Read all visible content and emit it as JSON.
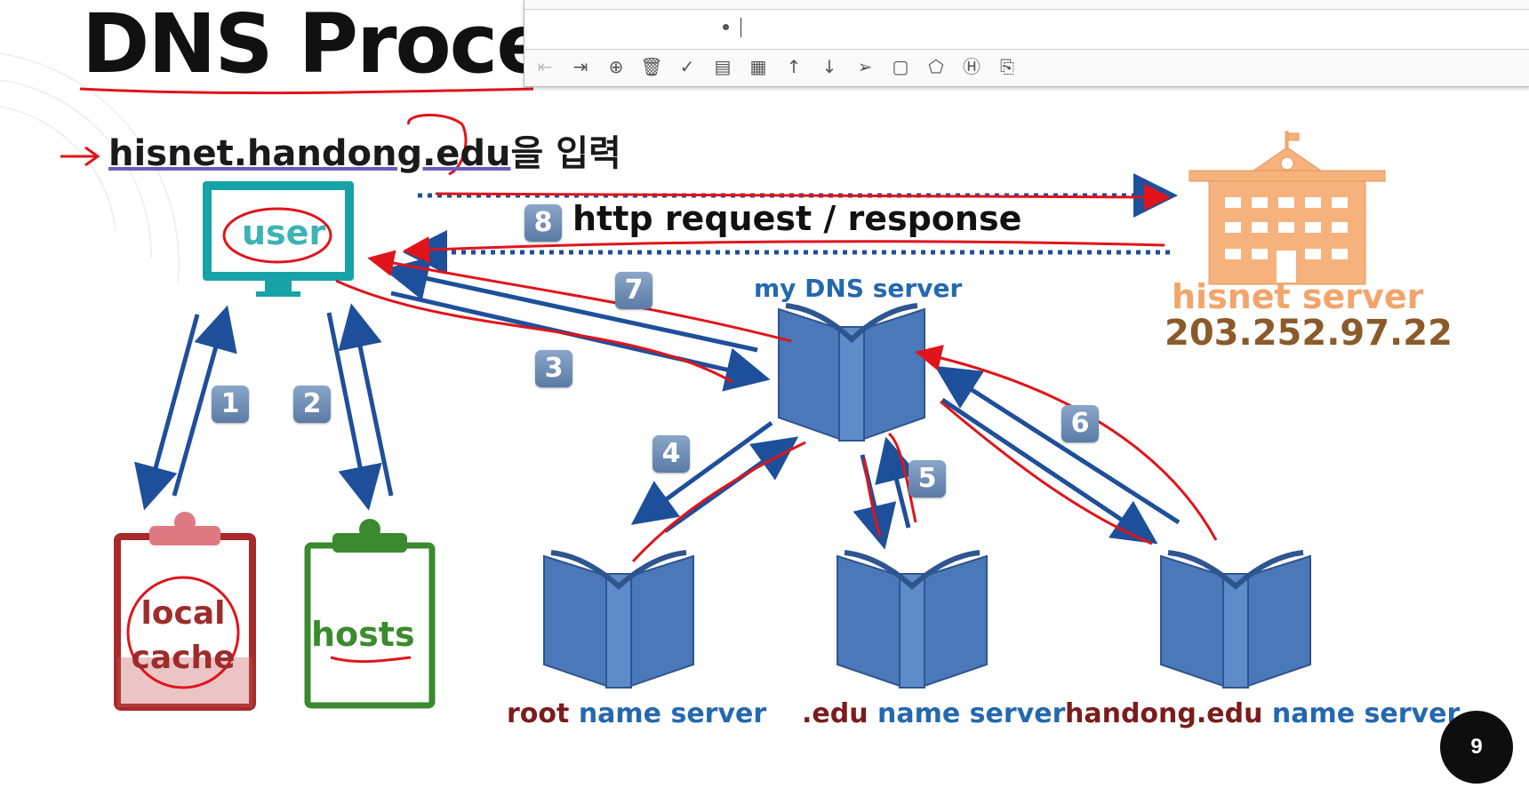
{
  "slide": {
    "title": "DNS Process",
    "instruction_url": "hisnet.handong.edu",
    "instruction_suffix": "을 입력",
    "user_label": "user",
    "local_cache_line1": "local",
    "local_cache_line2": "cache",
    "hosts_label": "hosts",
    "http_label": "http request / response",
    "my_dns_label": "my DNS server",
    "hisnet_name": "hisnet server",
    "hisnet_ip": "203.252.97.22",
    "root_prefix": "root",
    "edu_prefix": ".edu",
    "handong_prefix": "handong.edu",
    "name_server_suffix": "name server",
    "badges": [
      "1",
      "2",
      "3",
      "4",
      "5",
      "6",
      "7",
      "8"
    ],
    "page_number": "9",
    "colors": {
      "user_teal": "#17a2a6",
      "local_cache_red": "#9e2c2c",
      "hosts_green": "#3b8a2f",
      "book_blue": "#4a78b8",
      "arrow_blue": "#1e4f9a",
      "annotation_red": "#e0141a",
      "hisnet_orange": "#f5b27c"
    }
  },
  "toolbar": {
    "icons": [
      "outdent-icon",
      "indent-icon",
      "zoom-icon",
      "delete-icon",
      "check-icon",
      "note-icon",
      "calendar-icon",
      "move-up-icon",
      "move-down-icon",
      "send-icon",
      "square-icon",
      "tag-icon",
      "heading-icon",
      "attachment-icon"
    ]
  }
}
